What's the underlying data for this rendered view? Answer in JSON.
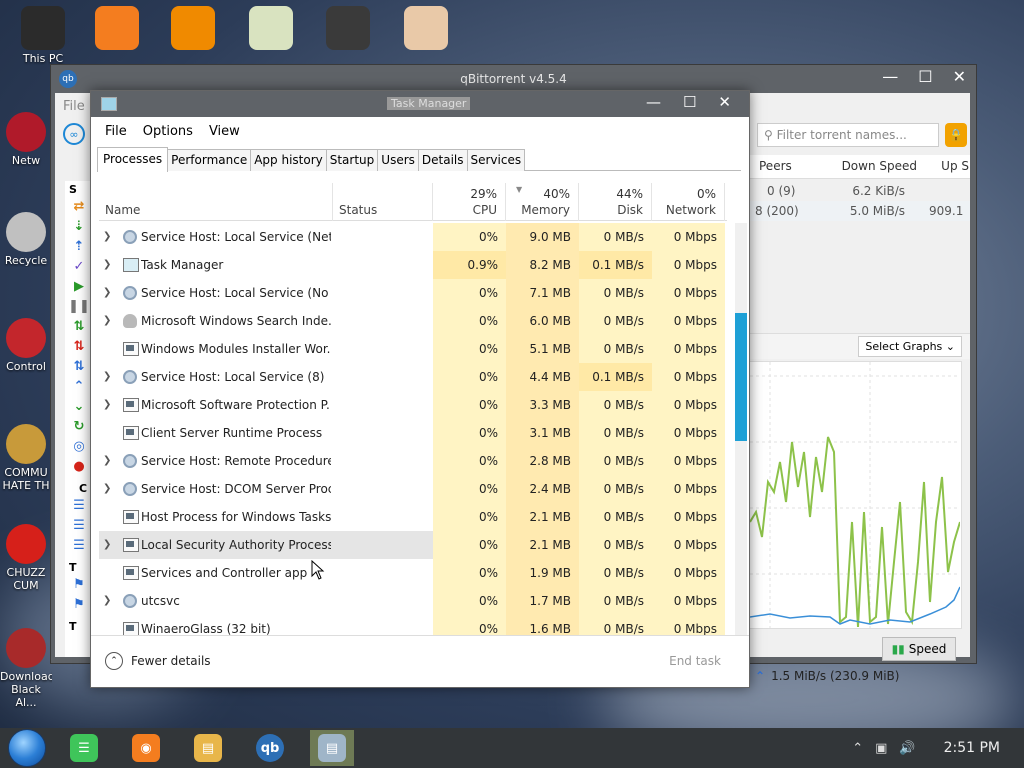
{
  "desktop": {
    "top_icons": [
      {
        "label": "This PC",
        "color": "#2b2b2b"
      },
      {
        "label": "",
        "color": "#f47d1f"
      },
      {
        "label": "",
        "color": "#f08a00"
      },
      {
        "label": "",
        "color": "#d9e3c0"
      },
      {
        "label": "",
        "color": "#3a3a3a"
      },
      {
        "label": "",
        "color": "#e9c9a8"
      }
    ],
    "left_icons": [
      {
        "label": "Netw",
        "color": "#b01a2a"
      },
      {
        "label": "Recycle",
        "color": "#c0c0c0"
      },
      {
        "label": "Control",
        "color": "#c3262c"
      },
      {
        "label": "COMMU HATE TH",
        "color": "#c89a3a"
      },
      {
        "label": "CHUZZ CUM",
        "color": "#d6201a"
      },
      {
        "label": "Download Black Al...",
        "color": "#a82a2a"
      }
    ]
  },
  "qbittorrent": {
    "title": "qBittorrent v4.5.4",
    "menu_file": "File",
    "filter_placeholder": "Filter torrent names...",
    "columns": [
      "Peers",
      "Down Speed",
      "Up S"
    ],
    "rows": [
      {
        "peers": "0 (9)",
        "down": "6.2 KiB/s",
        "up": ""
      },
      {
        "peers": "8 (200)",
        "down": "5.0 MiB/s",
        "up": "909.1"
      }
    ],
    "select_graphs": "Select Graphs",
    "speed_button": "Speed",
    "status": "1.5 MiB/s (230.9 MiB)",
    "sidebar_letters": [
      "S",
      "C",
      "T",
      "T"
    ]
  },
  "task_manager": {
    "title": "Task Manager",
    "menu": [
      "File",
      "Options",
      "View"
    ],
    "tabs": [
      "Processes",
      "Performance",
      "App history",
      "Startup",
      "Users",
      "Details",
      "Services"
    ],
    "active_tab": "Processes",
    "headers": {
      "name": "Name",
      "status": "Status",
      "cpu_pct": "29%",
      "cpu": "CPU",
      "mem_pct": "40%",
      "mem": "Memory",
      "disk_pct": "44%",
      "disk": "Disk",
      "net_pct": "0%",
      "net": "Network"
    },
    "processes": [
      {
        "name": "Service Host: Local Service (Net...",
        "icon": "gear",
        "expand": true,
        "cpu": "0%",
        "mem": "9.0 MB",
        "disk": "0 MB/s",
        "net": "0 Mbps"
      },
      {
        "name": "Task Manager",
        "icon": "tmgr",
        "expand": true,
        "cpu": "0.9%",
        "mem": "8.2 MB",
        "disk": "0.1 MB/s",
        "net": "0 Mbps"
      },
      {
        "name": "Service Host: Local Service (No ...",
        "icon": "gear",
        "expand": true,
        "cpu": "0%",
        "mem": "7.1 MB",
        "disk": "0 MB/s",
        "net": "0 Mbps"
      },
      {
        "name": "Microsoft Windows Search Inde...",
        "icon": "user",
        "expand": true,
        "cpu": "0%",
        "mem": "6.0 MB",
        "disk": "0 MB/s",
        "net": "0 Mbps"
      },
      {
        "name": "Windows Modules Installer Wor...",
        "icon": "win",
        "expand": false,
        "cpu": "0%",
        "mem": "5.1 MB",
        "disk": "0 MB/s",
        "net": "0 Mbps"
      },
      {
        "name": "Service Host: Local Service (8)",
        "icon": "gear",
        "expand": true,
        "cpu": "0%",
        "mem": "4.4 MB",
        "disk": "0.1 MB/s",
        "net": "0 Mbps"
      },
      {
        "name": "Microsoft Software Protection P...",
        "icon": "win",
        "expand": true,
        "cpu": "0%",
        "mem": "3.3 MB",
        "disk": "0 MB/s",
        "net": "0 Mbps"
      },
      {
        "name": "Client Server Runtime Process",
        "icon": "win",
        "expand": false,
        "cpu": "0%",
        "mem": "3.1 MB",
        "disk": "0 MB/s",
        "net": "0 Mbps"
      },
      {
        "name": "Service Host: Remote Procedure...",
        "icon": "gear",
        "expand": true,
        "cpu": "0%",
        "mem": "2.8 MB",
        "disk": "0 MB/s",
        "net": "0 Mbps"
      },
      {
        "name": "Service Host: DCOM Server Proc...",
        "icon": "gear",
        "expand": true,
        "cpu": "0%",
        "mem": "2.4 MB",
        "disk": "0 MB/s",
        "net": "0 Mbps"
      },
      {
        "name": "Host Process for Windows Tasks",
        "icon": "win",
        "expand": false,
        "cpu": "0%",
        "mem": "2.1 MB",
        "disk": "0 MB/s",
        "net": "0 Mbps"
      },
      {
        "name": "Local Security Authority Process",
        "icon": "win",
        "expand": true,
        "selected": true,
        "cpu": "0%",
        "mem": "2.1 MB",
        "disk": "0 MB/s",
        "net": "0 Mbps"
      },
      {
        "name": "Services and Controller app",
        "icon": "win",
        "expand": false,
        "cpu": "0%",
        "mem": "1.9 MB",
        "disk": "0 MB/s",
        "net": "0 Mbps"
      },
      {
        "name": "utcsvc",
        "icon": "gear",
        "expand": true,
        "cpu": "0%",
        "mem": "1.7 MB",
        "disk": "0 MB/s",
        "net": "0 Mbps"
      },
      {
        "name": "WinaeroGlass (32 bit)",
        "icon": "win",
        "expand": false,
        "cpu": "0%",
        "mem": "1.6 MB",
        "disk": "0 MB/s",
        "net": "0 Mbps"
      }
    ],
    "fewer_details": "Fewer details",
    "end_task": "End task"
  },
  "taskbar": {
    "apps": [
      {
        "name": "notes",
        "color": "#3fc55a",
        "active": false
      },
      {
        "name": "firefox",
        "color": "#f47d1f",
        "active": false
      },
      {
        "name": "explorer",
        "color": "#e8b64a",
        "active": false
      },
      {
        "name": "qbittorrent",
        "color": "#2d6fb5",
        "active": false
      },
      {
        "name": "task-manager",
        "color": "#9fb5c8",
        "active": true
      }
    ],
    "qb_label": "qb",
    "clock": "2:51 PM"
  }
}
